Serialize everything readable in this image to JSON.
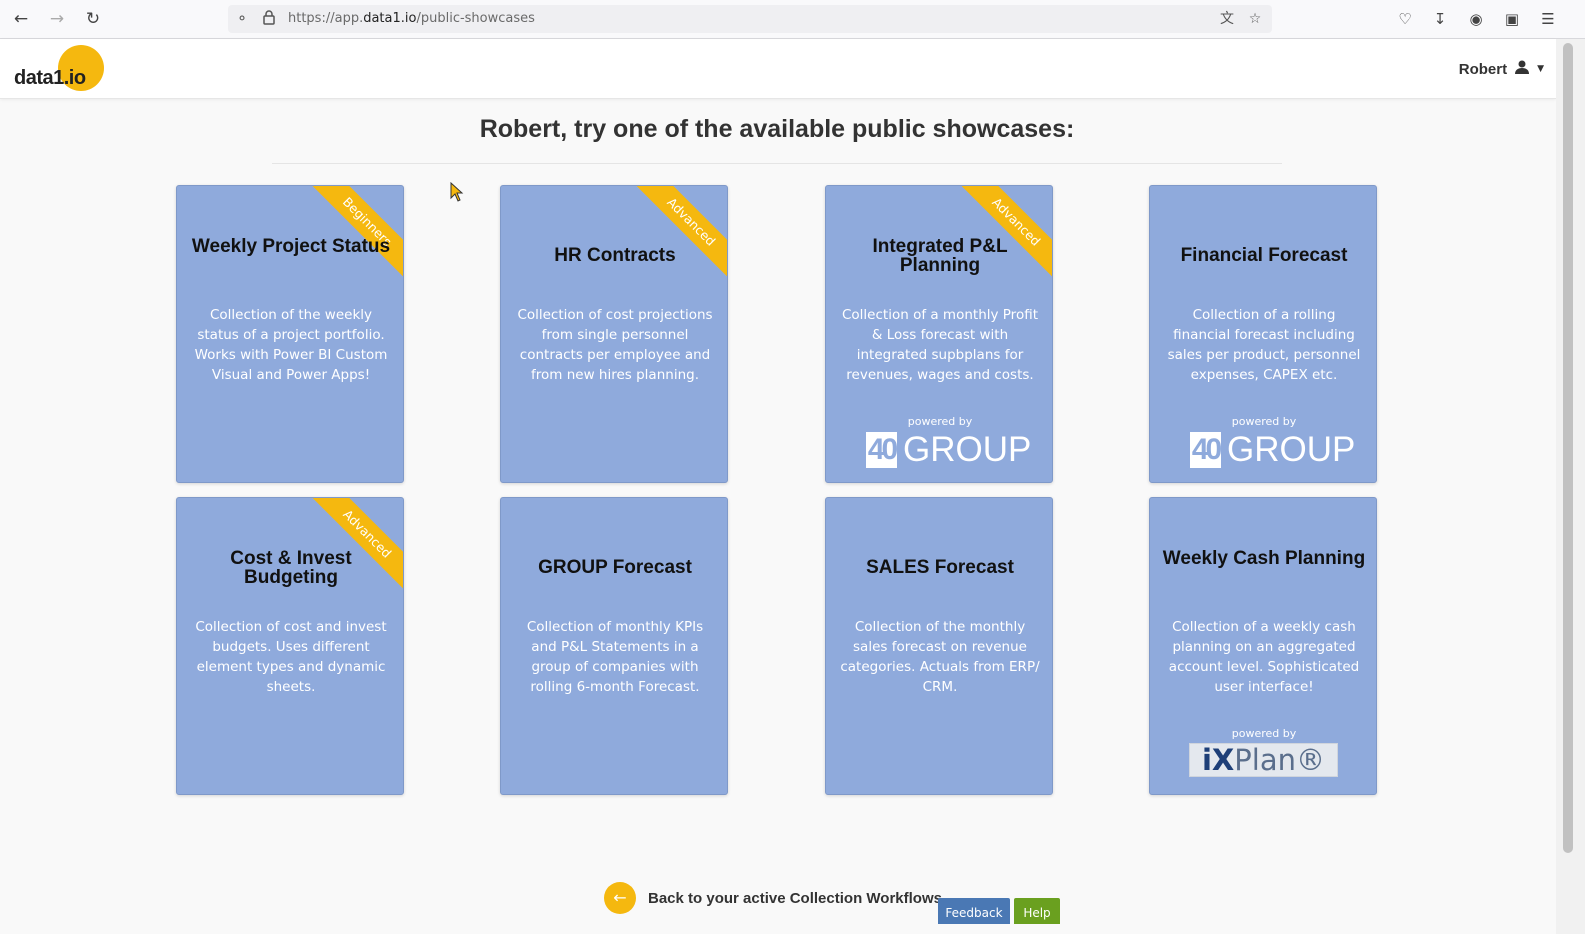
{
  "browser": {
    "url_prefix": "https://app.",
    "url_host": "data1.io",
    "url_path": "/public-showcases",
    "icons": [
      "back-icon",
      "forward-icon",
      "reload-icon",
      "shield-icon",
      "lock-icon",
      "translate-icon",
      "star-icon",
      "pocket-icon",
      "download-icon",
      "account-icon",
      "extensions-icon",
      "menu-icon"
    ]
  },
  "header": {
    "logo_text": "data1.io",
    "user_name": "Robert"
  },
  "main": {
    "title": "Robert, try one of the available public showcases:",
    "cards": [
      {
        "title": "Weekly Project Status",
        "description": "Collection of the weekly status of a project portfolio. Works with Power BI Custom Visual and Power Apps!",
        "ribbon": "Beginners"
      },
      {
        "title": "HR Contracts",
        "description": "Collection of cost projections from single personnel contracts per employee and from new hires planning.",
        "ribbon": "Advanced"
      },
      {
        "title": "Integrated P&L Planning",
        "description": "Collection of a monthly Profit & Loss forecast with integrated supbplans for revenues, wages and costs.",
        "ribbon": "Advanced",
        "powered_by": "powered by",
        "partner": "40 GROUP"
      },
      {
        "title": "Financial Forecast",
        "description": "Collection of a rolling financial forecast including sales per product, personnel expenses, CAPEX etc.",
        "powered_by": "powered by",
        "partner": "40 GROUP"
      },
      {
        "title": "Cost & Invest Budgeting",
        "description": "Collection of cost and invest budgets. Uses different element types and dynamic sheets.",
        "ribbon": "Advanced"
      },
      {
        "title": "GROUP Forecast",
        "description": "Collection of monthly KPIs and P&L Statements in a group of companies with rolling 6-month Forecast."
      },
      {
        "title": "SALES Forecast",
        "description": "Collection of the monthly sales forecast on revenue categories. Actuals from ERP/ CRM."
      },
      {
        "title": "Weekly Cash Planning",
        "description": "Collection of a weekly cash planning on an aggregated account level. Sophisticated user interface!",
        "powered_by": "powered by",
        "partner": "iXPlan®"
      }
    ]
  },
  "logos": {
    "forty_group_box": "40",
    "forty_group_word": "GROUP",
    "ixplan_ix": "iX",
    "ixplan_rest": "Plan®"
  },
  "footer": {
    "back_label": "Back to your active Collection Workflows",
    "feedback_label": "Feedback",
    "help_label": "Help"
  },
  "colors": {
    "accent": "#f5b80f",
    "card": "#8faadc",
    "feedback": "#4a78b4",
    "help": "#6aa01f"
  }
}
